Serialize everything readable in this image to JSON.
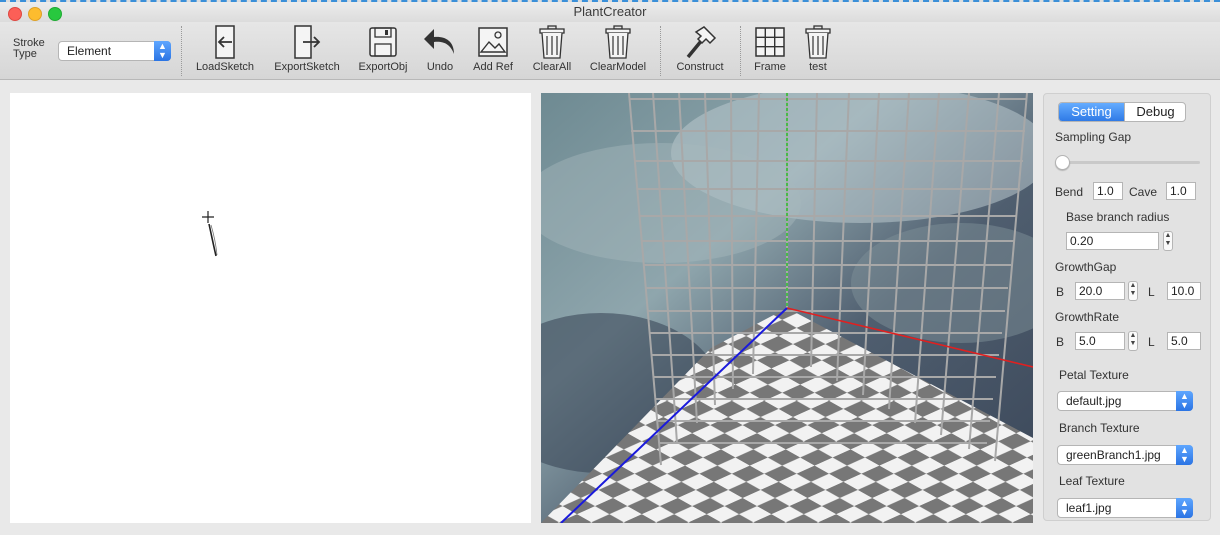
{
  "window": {
    "title": "PlantCreator"
  },
  "toolbar": {
    "stroke_type_label_1": "Stroke",
    "stroke_type_label_2": "Type",
    "stroke_type_value": "Element",
    "tools": {
      "load": "LoadSketch",
      "export_sketch": "ExportSketch",
      "export_obj": "ExportObj",
      "undo": "Undo",
      "add_ref": "Add Ref",
      "clear_all": "ClearAll",
      "clear_model": "ClearModel",
      "construct": "Construct",
      "frame": "Frame",
      "test": "test"
    }
  },
  "panel": {
    "tabs": {
      "setting": "Setting",
      "debug": "Debug"
    },
    "sampling_gap_label": "Sampling Gap",
    "sampling_gap_value": 0,
    "bend_label": "Bend",
    "bend_value": "1.0",
    "cave_label": "Cave",
    "cave_value": "1.0",
    "base_radius_label": "Base branch radius",
    "base_radius_value": "0.20",
    "growth_gap_label": "GrowthGap",
    "growth_gap_b_label": "B",
    "growth_gap_b_value": "20.0",
    "growth_gap_l_label": "L",
    "growth_gap_l_value": "10.0",
    "growth_rate_label": "GrowthRate",
    "growth_rate_b_label": "B",
    "growth_rate_b_value": "5.0",
    "growth_rate_l_label": "L",
    "growth_rate_l_value": "5.0",
    "petal_texture_label": "Petal Texture",
    "petal_texture_value": "default.jpg",
    "branch_texture_label": "Branch Texture",
    "branch_texture_value": "greenBranch1.jpg",
    "leaf_texture_label": "Leaf Texture",
    "leaf_texture_value": "leaf1.jpg"
  },
  "colors": {
    "accent": "#2f7ae6",
    "x_axis": "#e02020",
    "y_axis": "#30c030",
    "z_axis": "#1a1adc"
  }
}
